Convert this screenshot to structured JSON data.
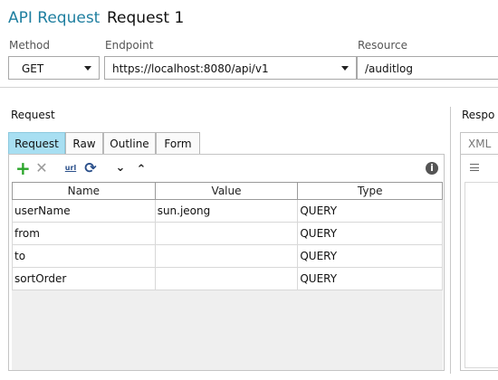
{
  "window": {
    "app_title": "API Request",
    "request_title": "Request 1"
  },
  "fields": {
    "method": {
      "label": "Method",
      "value": "GET"
    },
    "endpoint": {
      "label": "Endpoint",
      "value": "https://localhost:8080/api/v1"
    },
    "resource": {
      "label": "Resource",
      "value": "/auditlog"
    }
  },
  "request": {
    "section_label": "Request",
    "tabs": [
      {
        "label": "Request",
        "active": true
      },
      {
        "label": "Raw",
        "active": false
      },
      {
        "label": "Outline",
        "active": false
      },
      {
        "label": "Form",
        "active": false
      }
    ],
    "toolbar": [
      {
        "name": "add-icon",
        "glyph": "+",
        "color": "#2aa52a"
      },
      {
        "name": "delete-icon",
        "glyph": "✕",
        "color": "#9a9a9a"
      },
      {
        "name": "url-encode-icon",
        "glyph": "url",
        "color": "#2a4f8a"
      },
      {
        "name": "refresh-icon",
        "glyph": "⟳",
        "color": "#2a4f8a"
      },
      {
        "name": "move-down-icon",
        "glyph": "⌄",
        "color": "#222222"
      },
      {
        "name": "move-up-icon",
        "glyph": "⌃",
        "color": "#222222"
      },
      {
        "name": "info-icon",
        "glyph": "ℹ",
        "color": "#555555"
      }
    ],
    "columns": [
      "Name",
      "Value",
      "Type"
    ],
    "rows": [
      {
        "name": "userName",
        "value": "sun.jeong",
        "type": "QUERY"
      },
      {
        "name": "from",
        "value": "",
        "type": "QUERY"
      },
      {
        "name": "to",
        "value": "",
        "type": "QUERY"
      },
      {
        "name": "sortOrder",
        "value": "",
        "type": "QUERY"
      }
    ]
  },
  "response": {
    "section_label": "Respo",
    "tab_label": "XML"
  }
}
